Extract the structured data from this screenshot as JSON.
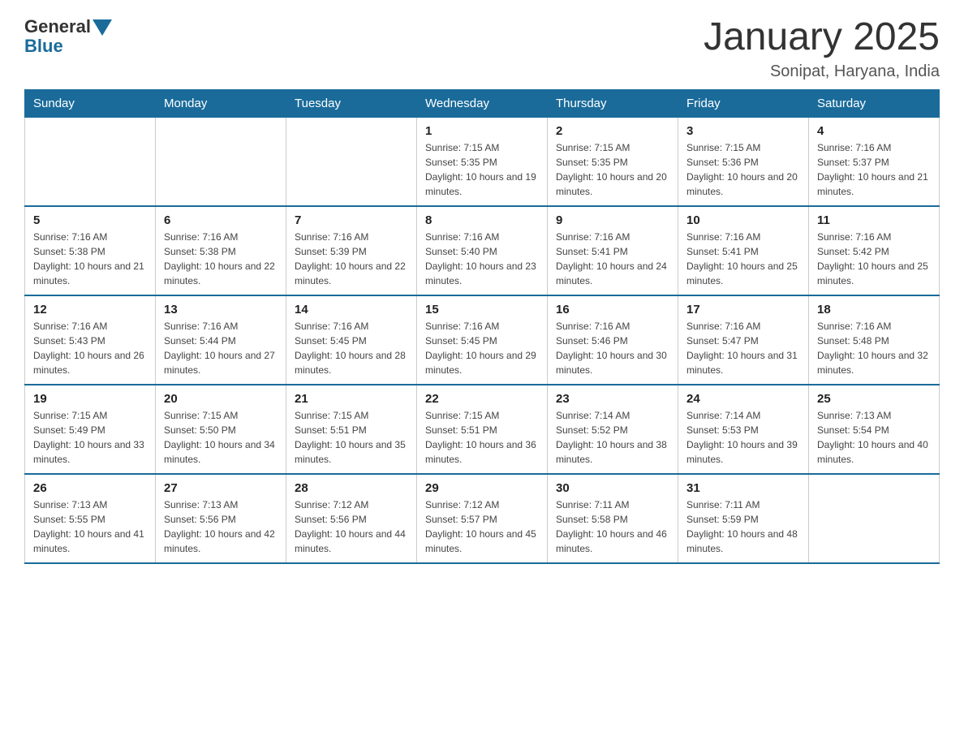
{
  "logo": {
    "general": "General",
    "blue": "Blue"
  },
  "header": {
    "title": "January 2025",
    "subtitle": "Sonipat, Haryana, India"
  },
  "weekdays": [
    "Sunday",
    "Monday",
    "Tuesday",
    "Wednesday",
    "Thursday",
    "Friday",
    "Saturday"
  ],
  "weeks": [
    [
      {
        "day": "",
        "sunrise": "",
        "sunset": "",
        "daylight": ""
      },
      {
        "day": "",
        "sunrise": "",
        "sunset": "",
        "daylight": ""
      },
      {
        "day": "",
        "sunrise": "",
        "sunset": "",
        "daylight": ""
      },
      {
        "day": "1",
        "sunrise": "Sunrise: 7:15 AM",
        "sunset": "Sunset: 5:35 PM",
        "daylight": "Daylight: 10 hours and 19 minutes."
      },
      {
        "day": "2",
        "sunrise": "Sunrise: 7:15 AM",
        "sunset": "Sunset: 5:35 PM",
        "daylight": "Daylight: 10 hours and 20 minutes."
      },
      {
        "day": "3",
        "sunrise": "Sunrise: 7:15 AM",
        "sunset": "Sunset: 5:36 PM",
        "daylight": "Daylight: 10 hours and 20 minutes."
      },
      {
        "day": "4",
        "sunrise": "Sunrise: 7:16 AM",
        "sunset": "Sunset: 5:37 PM",
        "daylight": "Daylight: 10 hours and 21 minutes."
      }
    ],
    [
      {
        "day": "5",
        "sunrise": "Sunrise: 7:16 AM",
        "sunset": "Sunset: 5:38 PM",
        "daylight": "Daylight: 10 hours and 21 minutes."
      },
      {
        "day": "6",
        "sunrise": "Sunrise: 7:16 AM",
        "sunset": "Sunset: 5:38 PM",
        "daylight": "Daylight: 10 hours and 22 minutes."
      },
      {
        "day": "7",
        "sunrise": "Sunrise: 7:16 AM",
        "sunset": "Sunset: 5:39 PM",
        "daylight": "Daylight: 10 hours and 22 minutes."
      },
      {
        "day": "8",
        "sunrise": "Sunrise: 7:16 AM",
        "sunset": "Sunset: 5:40 PM",
        "daylight": "Daylight: 10 hours and 23 minutes."
      },
      {
        "day": "9",
        "sunrise": "Sunrise: 7:16 AM",
        "sunset": "Sunset: 5:41 PM",
        "daylight": "Daylight: 10 hours and 24 minutes."
      },
      {
        "day": "10",
        "sunrise": "Sunrise: 7:16 AM",
        "sunset": "Sunset: 5:41 PM",
        "daylight": "Daylight: 10 hours and 25 minutes."
      },
      {
        "day": "11",
        "sunrise": "Sunrise: 7:16 AM",
        "sunset": "Sunset: 5:42 PM",
        "daylight": "Daylight: 10 hours and 25 minutes."
      }
    ],
    [
      {
        "day": "12",
        "sunrise": "Sunrise: 7:16 AM",
        "sunset": "Sunset: 5:43 PM",
        "daylight": "Daylight: 10 hours and 26 minutes."
      },
      {
        "day": "13",
        "sunrise": "Sunrise: 7:16 AM",
        "sunset": "Sunset: 5:44 PM",
        "daylight": "Daylight: 10 hours and 27 minutes."
      },
      {
        "day": "14",
        "sunrise": "Sunrise: 7:16 AM",
        "sunset": "Sunset: 5:45 PM",
        "daylight": "Daylight: 10 hours and 28 minutes."
      },
      {
        "day": "15",
        "sunrise": "Sunrise: 7:16 AM",
        "sunset": "Sunset: 5:45 PM",
        "daylight": "Daylight: 10 hours and 29 minutes."
      },
      {
        "day": "16",
        "sunrise": "Sunrise: 7:16 AM",
        "sunset": "Sunset: 5:46 PM",
        "daylight": "Daylight: 10 hours and 30 minutes."
      },
      {
        "day": "17",
        "sunrise": "Sunrise: 7:16 AM",
        "sunset": "Sunset: 5:47 PM",
        "daylight": "Daylight: 10 hours and 31 minutes."
      },
      {
        "day": "18",
        "sunrise": "Sunrise: 7:16 AM",
        "sunset": "Sunset: 5:48 PM",
        "daylight": "Daylight: 10 hours and 32 minutes."
      }
    ],
    [
      {
        "day": "19",
        "sunrise": "Sunrise: 7:15 AM",
        "sunset": "Sunset: 5:49 PM",
        "daylight": "Daylight: 10 hours and 33 minutes."
      },
      {
        "day": "20",
        "sunrise": "Sunrise: 7:15 AM",
        "sunset": "Sunset: 5:50 PM",
        "daylight": "Daylight: 10 hours and 34 minutes."
      },
      {
        "day": "21",
        "sunrise": "Sunrise: 7:15 AM",
        "sunset": "Sunset: 5:51 PM",
        "daylight": "Daylight: 10 hours and 35 minutes."
      },
      {
        "day": "22",
        "sunrise": "Sunrise: 7:15 AM",
        "sunset": "Sunset: 5:51 PM",
        "daylight": "Daylight: 10 hours and 36 minutes."
      },
      {
        "day": "23",
        "sunrise": "Sunrise: 7:14 AM",
        "sunset": "Sunset: 5:52 PM",
        "daylight": "Daylight: 10 hours and 38 minutes."
      },
      {
        "day": "24",
        "sunrise": "Sunrise: 7:14 AM",
        "sunset": "Sunset: 5:53 PM",
        "daylight": "Daylight: 10 hours and 39 minutes."
      },
      {
        "day": "25",
        "sunrise": "Sunrise: 7:13 AM",
        "sunset": "Sunset: 5:54 PM",
        "daylight": "Daylight: 10 hours and 40 minutes."
      }
    ],
    [
      {
        "day": "26",
        "sunrise": "Sunrise: 7:13 AM",
        "sunset": "Sunset: 5:55 PM",
        "daylight": "Daylight: 10 hours and 41 minutes."
      },
      {
        "day": "27",
        "sunrise": "Sunrise: 7:13 AM",
        "sunset": "Sunset: 5:56 PM",
        "daylight": "Daylight: 10 hours and 42 minutes."
      },
      {
        "day": "28",
        "sunrise": "Sunrise: 7:12 AM",
        "sunset": "Sunset: 5:56 PM",
        "daylight": "Daylight: 10 hours and 44 minutes."
      },
      {
        "day": "29",
        "sunrise": "Sunrise: 7:12 AM",
        "sunset": "Sunset: 5:57 PM",
        "daylight": "Daylight: 10 hours and 45 minutes."
      },
      {
        "day": "30",
        "sunrise": "Sunrise: 7:11 AM",
        "sunset": "Sunset: 5:58 PM",
        "daylight": "Daylight: 10 hours and 46 minutes."
      },
      {
        "day": "31",
        "sunrise": "Sunrise: 7:11 AM",
        "sunset": "Sunset: 5:59 PM",
        "daylight": "Daylight: 10 hours and 48 minutes."
      },
      {
        "day": "",
        "sunrise": "",
        "sunset": "",
        "daylight": ""
      }
    ]
  ]
}
